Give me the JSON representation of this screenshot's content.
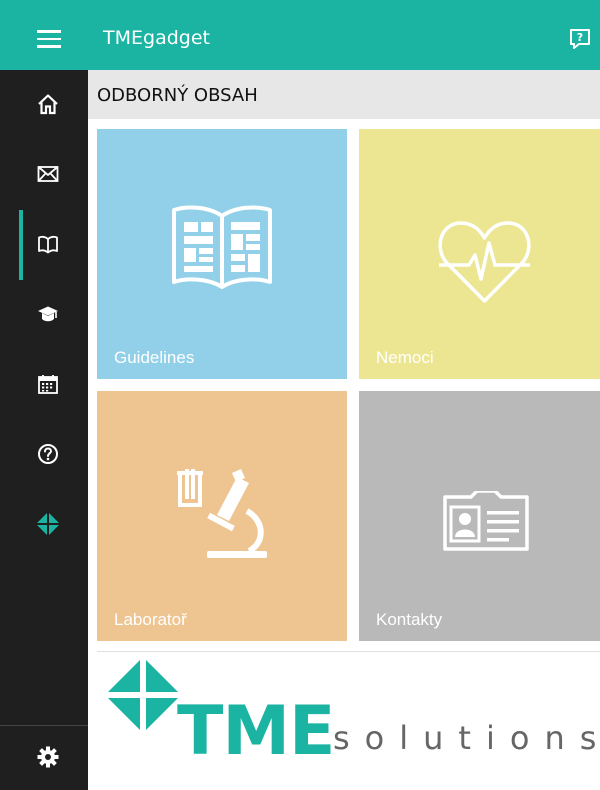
{
  "app": {
    "title": "TMEgadget"
  },
  "titlebar": {
    "icons": [
      "menu-icon",
      "feedback-icon"
    ]
  },
  "sidebar": {
    "items": [
      {
        "icon": "home-icon"
      },
      {
        "icon": "mail-icon"
      },
      {
        "icon": "book-icon",
        "active": true
      },
      {
        "icon": "graduation-cap-icon"
      },
      {
        "icon": "calendar-icon"
      },
      {
        "icon": "help-icon"
      },
      {
        "icon": "tme-logo-icon"
      },
      {
        "icon": "settings-icon"
      }
    ],
    "active_color": "#1bb3a2"
  },
  "section": {
    "title": "ODBORNÝ OBSAH"
  },
  "tiles": [
    {
      "label": "Guidelines",
      "icon": "guidelines-book-icon",
      "color": "#92d0ea"
    },
    {
      "label": "Nemoci",
      "icon": "heart-pulse-icon",
      "color": "#ece693"
    },
    {
      "label": "Laboratoř",
      "icon": "microscope-icon",
      "color": "#eec491"
    },
    {
      "label": "Kontakty",
      "icon": "contact-card-icon",
      "color": "#b9b9b9"
    }
  ],
  "footer_logo": {
    "brand": "TME",
    "suffix": "solutions",
    "brand_color": "#1bb3a2"
  }
}
